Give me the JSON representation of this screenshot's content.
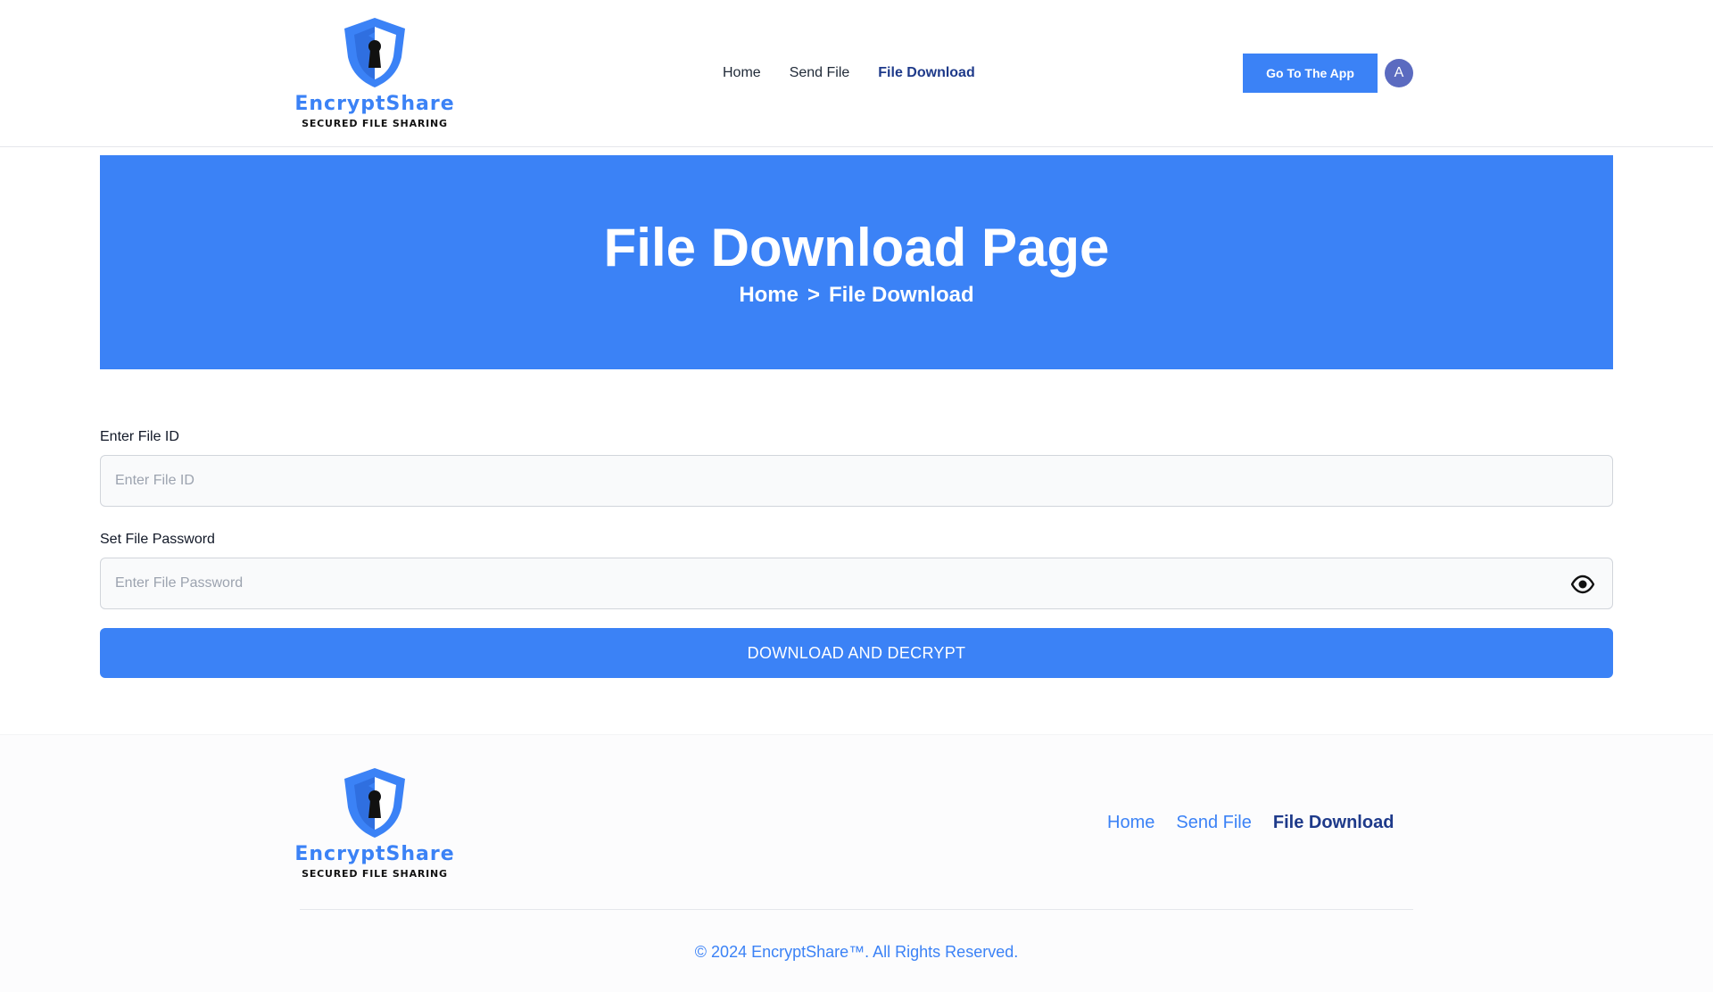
{
  "brand": {
    "name": "EncryptShare",
    "tagline": "SECURED FILE SHARING",
    "accent_color": "#3b82f6",
    "logo_icon": "shield-keyhole-icon"
  },
  "header": {
    "nav": [
      {
        "label": "Home",
        "active": false
      },
      {
        "label": "Send File",
        "active": false
      },
      {
        "label": "File Download",
        "active": true
      }
    ],
    "cta_label": "Go To The App",
    "avatar_initial": "A"
  },
  "hero": {
    "title": "File Download Page",
    "breadcrumb": {
      "home": "Home",
      "separator": ">",
      "current": "File Download"
    },
    "background_color": "#3b82f6"
  },
  "form": {
    "file_id": {
      "label": "Enter File ID",
      "placeholder": "Enter File ID",
      "value": ""
    },
    "password": {
      "label": "Set File Password",
      "placeholder": "Enter File Password",
      "value": "",
      "toggle_icon": "eye-icon"
    },
    "submit_label": "DOWNLOAD AND DECRYPT"
  },
  "footer": {
    "nav": [
      {
        "label": "Home",
        "active": false
      },
      {
        "label": "Send File",
        "active": false
      },
      {
        "label": "File Download",
        "active": true
      }
    ],
    "copyright": "© 2024 EncryptShare™. All Rights Reserved."
  }
}
